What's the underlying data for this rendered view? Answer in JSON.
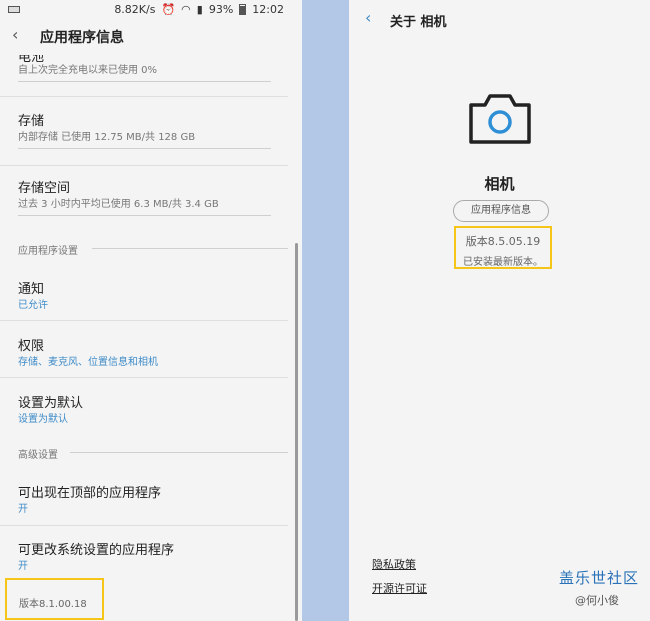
{
  "left": {
    "status": {
      "speed": "8.82K/s",
      "battery": "93%",
      "time": "12:02"
    },
    "header": {
      "back_icon": "‹",
      "title": "应用程序信息"
    },
    "battery_row": {
      "title": "电池",
      "subtitle": "自上次完全充电以来已使用 0%"
    },
    "storage_row": {
      "title": "存储",
      "subtitle": "内部存储 已使用 12.75 MB/共 128 GB"
    },
    "memory_row": {
      "title": "存储空间",
      "subtitle": "过去 3 小时内平均已使用 6.3 MB/共 3.4 GB"
    },
    "section_app_settings": "应用程序设置",
    "notify_row": {
      "title": "通知",
      "subtitle": "已允许"
    },
    "perm_row": {
      "title": "权限",
      "subtitle": "存储、麦克风、位置信息和相机"
    },
    "default_row": {
      "title": "设置为默认",
      "subtitle": "设置为默认"
    },
    "section_advanced": "高级设置",
    "top_row": {
      "title": "可出现在顶部的应用程序",
      "subtitle": "开"
    },
    "modify_row": {
      "title": "可更改系统设置的应用程序",
      "subtitle": "开"
    },
    "version": "版本8.1.00.18"
  },
  "right": {
    "header": {
      "back_icon": "‹",
      "title": "关于 相机"
    },
    "icon": "camera-icon",
    "app_name": "相机",
    "info_button": "应用程序信息",
    "version": "版本8.5.05.19",
    "latest": "已安装最新版本。",
    "privacy": "隐私政策",
    "license": "开源许可证",
    "watermark_brand": "盖乐世社区",
    "watermark_author": "@何小俊"
  },
  "colors": {
    "accent": "#3f8cc9",
    "highlight": "#f5c518",
    "separator": "#b3c8e7",
    "background": "#f4f4f4"
  }
}
